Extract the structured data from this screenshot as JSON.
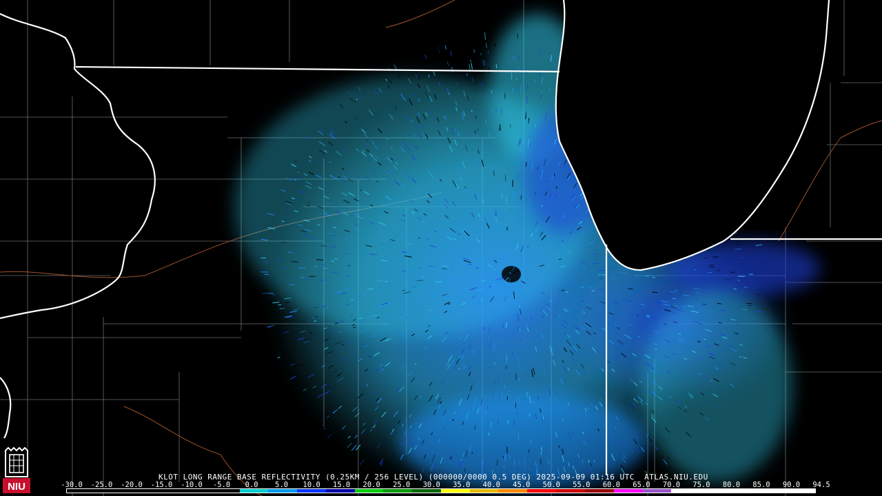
{
  "caption": "KLOT LONG RANGE BASE REFLECTIVITY (0.25KM / 256 LEVEL) (000000/0000 0.5 DEG) 2025-09-09 01:16 UTC  ATLAS.NIU.EDU",
  "logo_text": "NIU",
  "scale": {
    "labels": [
      "-30.0",
      "-25.0",
      "-20.0",
      "-15.0",
      "-10.0",
      "-5.0",
      "0.0",
      "5.0",
      "10.0",
      "15.0",
      "20.0",
      "25.0",
      "30.0",
      "35.0",
      "40.0",
      "45.0",
      "50.0",
      "55.0",
      "60.0",
      "65.0",
      "70.0",
      "75.0",
      "80.0",
      "85.0",
      "90.0",
      "94.5"
    ],
    "colors": [
      "#000000",
      "#000000",
      "#000000",
      "#000000",
      "#000000",
      "#000000",
      "#00cccc",
      "#0099ee",
      "#0033ff",
      "#0000aa",
      "#00cc00",
      "#009900",
      "#006600",
      "#ffff00",
      "#e6b800",
      "#ff8800",
      "#ff0000",
      "#cc0000",
      "#990000",
      "#ff00ff",
      "#9955cc",
      "#ffffff",
      "#ffffff",
      "#ffffff",
      "#ffffff",
      "#ffffff"
    ]
  },
  "colors": {
    "echo_light": "#33ccee",
    "echo_mid": "#1e90ff",
    "echo_dark": "#1f3fd8",
    "state_line": "#ffffff",
    "county_line": "#6e6e6e",
    "river_line": "#a0522d"
  }
}
